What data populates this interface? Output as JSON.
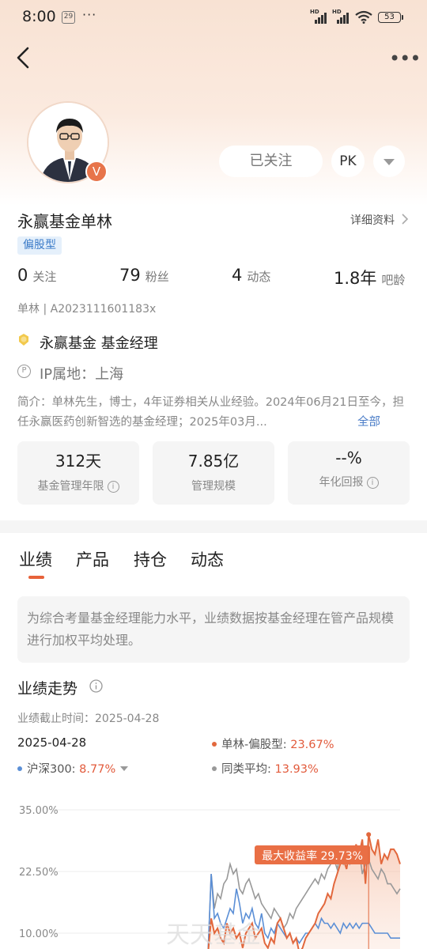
{
  "status": {
    "time": "8:00",
    "calendar_day": "29",
    "battery": "53"
  },
  "header": {
    "follow_label": "已关注",
    "pk_label": "PK",
    "badge_letter": "V"
  },
  "profile": {
    "name": "永赢基金单林",
    "detail_link": "详细资料",
    "tag": "偏股型",
    "stats": [
      {
        "value": "0",
        "label": "关注"
      },
      {
        "value": "79",
        "label": "粉丝"
      },
      {
        "value": "4",
        "label": "动态"
      },
      {
        "value": "1.8年",
        "label": "吧龄"
      }
    ],
    "uid": "单林 | A2023111601183x",
    "org": "永赢基金 基金经理",
    "ip": "IP属地：上海",
    "intro": "简介：单林先生，博士，4年证券相关从业经验。2024年06月21日至今，担任永赢医药创新智选的基金经理；2025年03月...",
    "intro_more": "全部"
  },
  "cards": [
    {
      "value": "312天",
      "label": "基金管理年限",
      "has_info": true
    },
    {
      "value": "7.85亿",
      "label": "管理规模",
      "has_info": false
    },
    {
      "value": "--%",
      "label": "年化回报",
      "has_info": true
    }
  ],
  "tabs": [
    {
      "label": "业绩",
      "active": true
    },
    {
      "label": "产品",
      "active": false
    },
    {
      "label": "持仓",
      "active": false
    },
    {
      "label": "动态",
      "active": false
    }
  ],
  "notice": "为综合考量基金经理能力水平，业绩数据按基金经理在管产品规模进行加权平均处理。",
  "performance": {
    "title": "业绩走势",
    "as_of": "业绩截止时间：2025-04-28",
    "date": "2025-04-28",
    "legend": [
      {
        "name": "单林-偏股型:",
        "value": "23.67%",
        "color": "#e2683d"
      },
      {
        "name": "沪深300:",
        "value": "8.77%",
        "color": "#5b8fd6"
      },
      {
        "name": "同类平均:",
        "value": "13.93%",
        "color": "#999999"
      }
    ]
  },
  "chart_data": {
    "type": "line",
    "y_ticks": [
      "35.00%",
      "22.50%",
      "10.00%"
    ],
    "ylim": [
      10,
      35
    ],
    "annotation": "最大收益率 29.73%",
    "series": [
      {
        "name": "单林-偏股型",
        "color": "#e2683d",
        "area": true,
        "values": [
          5,
          5,
          5,
          5,
          5,
          5,
          5,
          5,
          5,
          5,
          5,
          5,
          5,
          5,
          5,
          5,
          5,
          5,
          5,
          5,
          5,
          5,
          5,
          5,
          5,
          5,
          5,
          5,
          5,
          5,
          5,
          5,
          5,
          5,
          5,
          5,
          5,
          5,
          5,
          5,
          5,
          5,
          5,
          5,
          5,
          5,
          5,
          5,
          5,
          13,
          10,
          11,
          9,
          8,
          12,
          10,
          11,
          9,
          10,
          7,
          10,
          11,
          12,
          9,
          10,
          11,
          8,
          7,
          9,
          8,
          12,
          13,
          11,
          9,
          10,
          8,
          9,
          6,
          7,
          9,
          10,
          11,
          12,
          14,
          15,
          16,
          18,
          17,
          20,
          22,
          24,
          25,
          23,
          27,
          24,
          28,
          26,
          29,
          20,
          30,
          27,
          26,
          29,
          24,
          26,
          25,
          27,
          27,
          26,
          24
        ]
      },
      {
        "name": "沪深300",
        "color": "#5b8fd6",
        "area": false,
        "values": [
          5,
          5,
          5,
          5,
          5,
          5,
          5,
          5,
          5,
          5,
          5,
          5,
          5,
          5,
          5,
          5,
          5,
          5,
          5,
          5,
          5,
          5,
          5,
          5,
          5,
          5,
          5,
          5,
          5,
          5,
          5,
          5,
          5,
          5,
          5,
          5,
          5,
          5,
          5,
          5,
          5,
          5,
          5,
          5,
          5,
          5,
          5,
          5,
          5,
          22,
          13,
          14,
          12,
          11,
          13,
          15,
          14,
          19,
          16,
          12,
          14,
          13,
          15,
          12,
          11,
          14,
          10,
          9,
          11,
          10,
          12,
          11,
          10,
          9,
          10,
          8,
          9,
          8,
          9,
          10,
          10,
          11,
          12,
          11,
          13,
          12,
          12,
          11,
          12,
          11,
          10,
          12,
          11,
          12,
          11,
          12,
          11,
          12,
          12,
          12,
          11,
          10,
          10,
          10,
          10,
          10,
          9,
          9,
          9,
          9
        ]
      },
      {
        "name": "同类平均",
        "color": "#999999",
        "area": false,
        "values": [
          5,
          5,
          5,
          5,
          5,
          5,
          5,
          5,
          5,
          5,
          5,
          5,
          5,
          5,
          5,
          5,
          5,
          5,
          5,
          5,
          5,
          5,
          5,
          5,
          5,
          5,
          5,
          5,
          5,
          5,
          5,
          5,
          5,
          5,
          5,
          5,
          5,
          5,
          5,
          5,
          5,
          5,
          5,
          5,
          5,
          5,
          5,
          5,
          5,
          22,
          15,
          18,
          17,
          20,
          21,
          24,
          22,
          23,
          19,
          18,
          20,
          21,
          19,
          17,
          18,
          16,
          15,
          14,
          13,
          15,
          14,
          13,
          11,
          12,
          14,
          13,
          15,
          16,
          17,
          18,
          19,
          20,
          21,
          20,
          22,
          21,
          23,
          24,
          25,
          23,
          26,
          24,
          25,
          24,
          26,
          25,
          27,
          22,
          24,
          25,
          23,
          22,
          21,
          23,
          22,
          20,
          20,
          19,
          18,
          19
        ]
      }
    ]
  },
  "watermark": "天天基金"
}
